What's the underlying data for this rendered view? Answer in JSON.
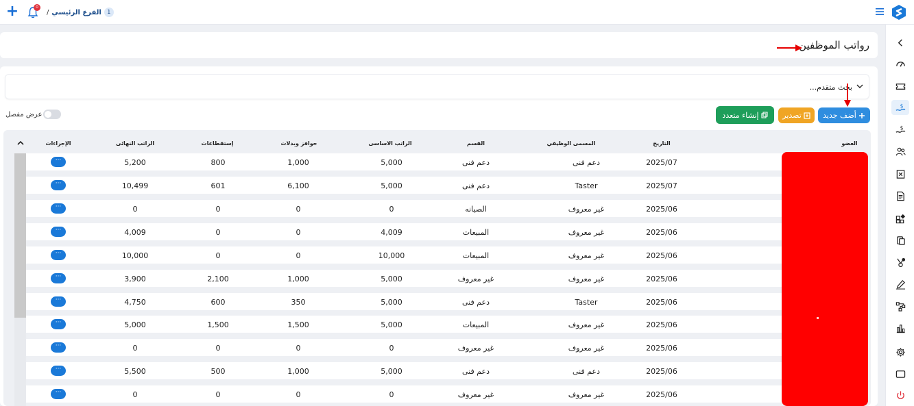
{
  "topbar": {
    "breadcrumb_number": "1",
    "breadcrumb_name": "الفرع الرئيسي",
    "breadcrumb_separator": "/",
    "notification_count": "0"
  },
  "page": {
    "title": "رواتب الموظفين"
  },
  "search": {
    "label": "بحث متقدم..."
  },
  "toolbar": {
    "add_label": "أضف جديد",
    "export_label": "تصدير",
    "bulk_create_label": "إنشاء متعدد",
    "detailed_view_label": "عرض مفصل"
  },
  "table": {
    "columns": {
      "member": "العضو",
      "date": "التاريخ",
      "job_title": "المسمى الوظيفي",
      "department": "القسم",
      "base_salary": "الراتب الاساسى",
      "allowances": "حوافز وبدلات",
      "deductions": "إستقطاعات",
      "final_salary": "الراتب النهائى",
      "actions": "الإجراءات"
    },
    "action_label": "···",
    "rows": [
      {
        "date": "2025/07",
        "job_title": "دعم فنى",
        "department": "دعم فنى",
        "base_salary": "5,000",
        "allowances": "1,000",
        "deductions": "800",
        "final_salary": "5,200"
      },
      {
        "date": "2025/07",
        "job_title": "Taster",
        "department": "دعم فنى",
        "base_salary": "5,000",
        "allowances": "6,100",
        "deductions": "601",
        "final_salary": "10,499"
      },
      {
        "date": "2025/06",
        "job_title": "غير معروف",
        "department": "الصيانه",
        "base_salary": "0",
        "allowances": "0",
        "deductions": "0",
        "final_salary": "0"
      },
      {
        "date": "2025/06",
        "job_title": "غير معروف",
        "department": "المبيعات",
        "base_salary": "4,009",
        "allowances": "0",
        "deductions": "0",
        "final_salary": "4,009"
      },
      {
        "date": "2025/06",
        "job_title": "غير معروف",
        "department": "المبيعات",
        "base_salary": "10,000",
        "allowances": "0",
        "deductions": "0",
        "final_salary": "10,000"
      },
      {
        "date": "2025/06",
        "job_title": "غير معروف",
        "department": "غير معروف",
        "base_salary": "5,000",
        "allowances": "1,000",
        "deductions": "2,100",
        "final_salary": "3,900"
      },
      {
        "date": "2025/06",
        "job_title": "Taster",
        "department": "دعم فنى",
        "base_salary": "5,000",
        "allowances": "350",
        "deductions": "600",
        "final_salary": "4,750"
      },
      {
        "date": "2025/06",
        "job_title": "غير معروف",
        "department": "المبيعات",
        "base_salary": "5,000",
        "allowances": "1,500",
        "deductions": "1,500",
        "final_salary": "5,000"
      },
      {
        "date": "2025/06",
        "job_title": "غير معروف",
        "department": "غير معروف",
        "base_salary": "0",
        "allowances": "0",
        "deductions": "0",
        "final_salary": "0"
      },
      {
        "date": "2025/06",
        "job_title": "دعم فنى",
        "department": "دعم فنى",
        "base_salary": "5,000",
        "allowances": "1,000",
        "deductions": "500",
        "final_salary": "5,500"
      },
      {
        "date": "2025/06",
        "job_title": "غير معروف",
        "department": "غير معروف",
        "base_salary": "0",
        "allowances": "0",
        "deductions": "0",
        "final_salary": "0"
      }
    ]
  },
  "colors": {
    "primary": "#2f8ddf",
    "export": "#f0a524",
    "bulk_create": "#1e9e5a",
    "annotation_red": "#e60000"
  },
  "icons": [
    "plus-icon",
    "bell-icon",
    "menu-icon",
    "logo-icon",
    "chevron-left-icon",
    "dashboard-icon",
    "ticket-icon",
    "salary-icon",
    "money-icon",
    "users-icon",
    "excel-icon",
    "document-icon",
    "widgets-icon",
    "cards-icon",
    "badge-icon",
    "signature-icon",
    "flow-icon",
    "chart-icon",
    "gear-icon",
    "window-icon",
    "power-icon"
  ]
}
